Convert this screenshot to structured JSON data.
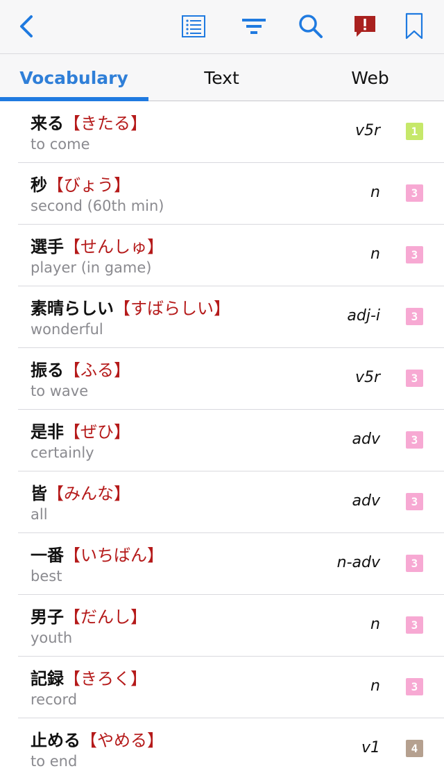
{
  "toolbar": {
    "icons": [
      "back-chevron-icon",
      "list-icon",
      "filter-icon",
      "search-icon",
      "report-icon",
      "bookmark-icon"
    ]
  },
  "tabs": [
    {
      "label": "Vocabulary",
      "active": true
    },
    {
      "label": "Text",
      "active": false
    },
    {
      "label": "Web",
      "active": false
    }
  ],
  "colors": {
    "accent": "#1f7ae0",
    "kana": "#b51a1a",
    "report_red": "#a9211f",
    "level_1": "#c6e86a",
    "level_3": "#f7a9d3",
    "level_4": "#b5a08f"
  },
  "vocab": [
    {
      "kanji": "来る",
      "kana": "【きたる】",
      "meaning": "to come",
      "pos": "v5r",
      "level": "1",
      "level_color": "#c6e86a"
    },
    {
      "kanji": "秒",
      "kana": "【びょう】",
      "meaning": "second (60th min)",
      "pos": "n",
      "level": "3",
      "level_color": "#f7a9d3"
    },
    {
      "kanji": "選手",
      "kana": "【せんしゅ】",
      "meaning": "player (in game)",
      "pos": "n",
      "level": "3",
      "level_color": "#f7a9d3"
    },
    {
      "kanji": "素晴らしい",
      "kana": "【すばらしい】",
      "meaning": "wonderful",
      "pos": "adj-i",
      "level": "3",
      "level_color": "#f7a9d3"
    },
    {
      "kanji": "振る",
      "kana": "【ふる】",
      "meaning": "to wave",
      "pos": "v5r",
      "level": "3",
      "level_color": "#f7a9d3"
    },
    {
      "kanji": "是非",
      "kana": "【ぜひ】",
      "meaning": "certainly",
      "pos": "adv",
      "level": "3",
      "level_color": "#f7a9d3"
    },
    {
      "kanji": "皆",
      "kana": "【みんな】",
      "meaning": "all",
      "pos": "adv",
      "level": "3",
      "level_color": "#f7a9d3"
    },
    {
      "kanji": "一番",
      "kana": "【いちばん】",
      "meaning": "best",
      "pos": "n-adv",
      "level": "3",
      "level_color": "#f7a9d3"
    },
    {
      "kanji": "男子",
      "kana": "【だんし】",
      "meaning": "youth",
      "pos": "n",
      "level": "3",
      "level_color": "#f7a9d3"
    },
    {
      "kanji": "記録",
      "kana": "【きろく】",
      "meaning": "record",
      "pos": "n",
      "level": "3",
      "level_color": "#f7a9d3"
    },
    {
      "kanji": "止める",
      "kana": "【やめる】",
      "meaning": "to end",
      "pos": "v1",
      "level": "4",
      "level_color": "#b5a08f"
    }
  ]
}
